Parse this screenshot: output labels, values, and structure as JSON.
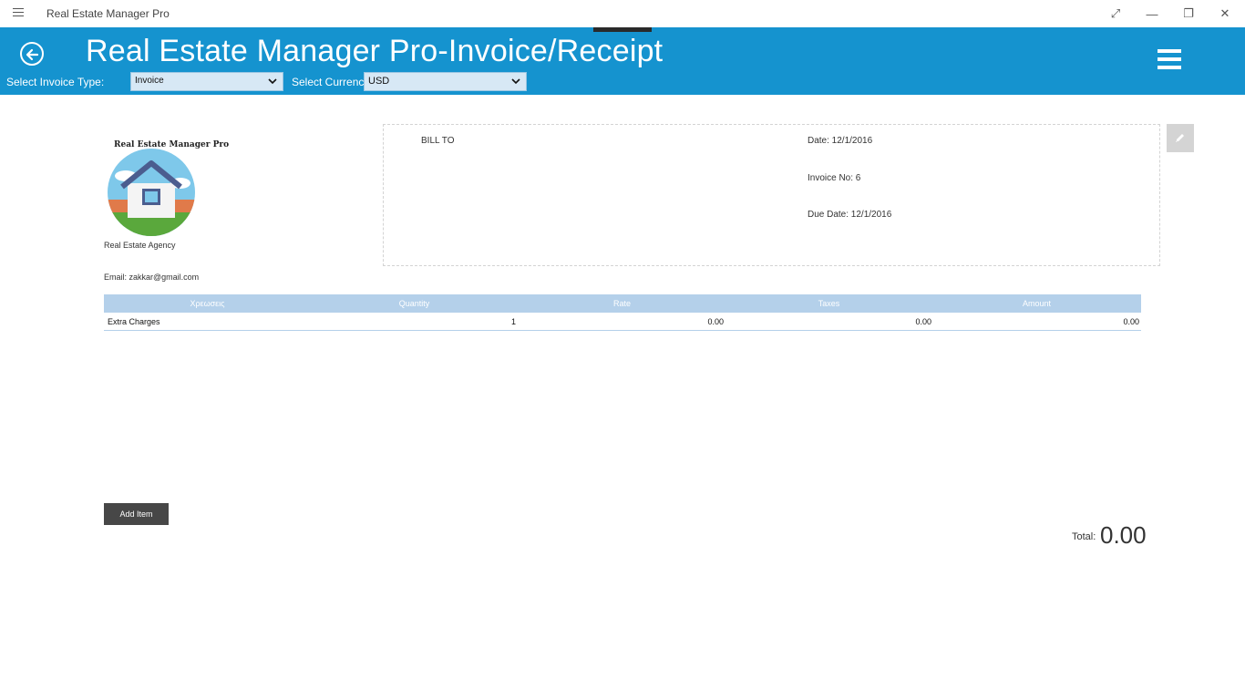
{
  "titlebar": {
    "app_title": "Real Estate Manager Pro",
    "menu_icon": "hamburger-icon",
    "buttons": [
      "expand-icon",
      "minimize-icon",
      "restore-icon",
      "close-icon"
    ]
  },
  "header": {
    "title": "Real Estate Manager Pro-Invoice/Receipt",
    "accent_color": "#1593cf",
    "invoice_type_label": "Select Invoice Type:",
    "invoice_type_value": "Invoice",
    "currency_label": "Select Currency:",
    "currency_value": "USD"
  },
  "company": {
    "logo_caption": "Real Estate Manager Pro",
    "name": "Real Estate Agency",
    "email": "Email: zakkar@gmail.com"
  },
  "bill": {
    "bill_to": "BILL TO",
    "date": "Date: 12/1/2016",
    "invoice_no": "Invoice No: 6",
    "due_date": "Due Date: 12/1/2016"
  },
  "table": {
    "headers": [
      "Χρεωσεις",
      "Quantity",
      "Rate",
      "Taxes",
      "Amount"
    ],
    "rows": [
      {
        "item": "Extra Charges",
        "quantity": "1",
        "rate": "0.00",
        "taxes": "0.00",
        "amount": "0.00"
      }
    ]
  },
  "actions": {
    "add_item": "Add Item"
  },
  "totals": {
    "label": "Total:",
    "value": "0.00"
  }
}
